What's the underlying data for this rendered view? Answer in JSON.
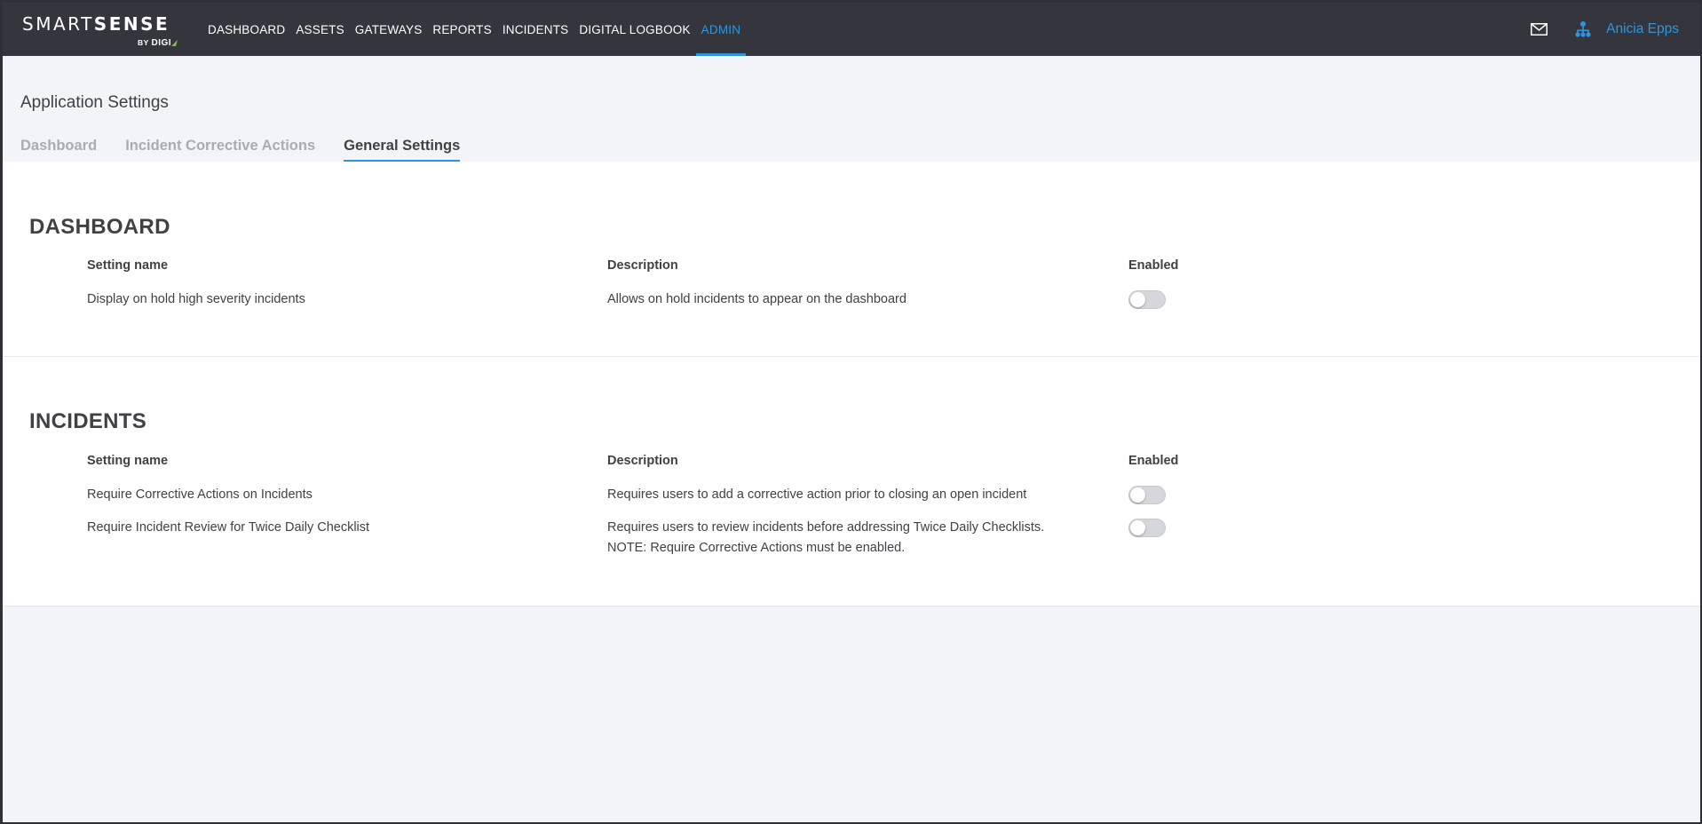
{
  "brand": {
    "name_light": "SMART",
    "name_bold": "SENSE",
    "by": "BY",
    "digi": "DIGI"
  },
  "nav": {
    "items": [
      {
        "label": "DASHBOARD",
        "active": false
      },
      {
        "label": "ASSETS",
        "active": false
      },
      {
        "label": "GATEWAYS",
        "active": false
      },
      {
        "label": "REPORTS",
        "active": false
      },
      {
        "label": "INCIDENTS",
        "active": false
      },
      {
        "label": "DIGITAL LOGBOOK",
        "active": false
      },
      {
        "label": "ADMIN",
        "active": true
      }
    ],
    "accent_color": "#2d95e0"
  },
  "header": {
    "icons": [
      "mail-icon",
      "org-chart-icon"
    ],
    "user_name": "Anicia Epps"
  },
  "page": {
    "title": "Application Settings",
    "tabs": [
      {
        "label": "Dashboard",
        "active": false
      },
      {
        "label": "Incident Corrective Actions",
        "active": false
      },
      {
        "label": "General Settings",
        "active": true
      }
    ]
  },
  "sections": [
    {
      "title": "DASHBOARD",
      "columns": [
        "Setting name",
        "Description",
        "Enabled"
      ],
      "rows": [
        {
          "name": "Display on hold high severity incidents",
          "description": [
            "Allows on hold incidents to appear on the dashboard"
          ],
          "enabled": false
        }
      ]
    },
    {
      "title": "INCIDENTS",
      "columns": [
        "Setting name",
        "Description",
        "Enabled"
      ],
      "rows": [
        {
          "name": "Require Corrective Actions on Incidents",
          "description": [
            "Requires users to add a corrective action prior to closing an open incident"
          ],
          "enabled": false
        },
        {
          "name": "Require Incident Review for Twice Daily Checklist",
          "description": [
            "Requires users to review incidents before addressing Twice Daily Checklists.",
            "NOTE: Require Corrective Actions must be enabled."
          ],
          "enabled": false
        }
      ]
    }
  ]
}
